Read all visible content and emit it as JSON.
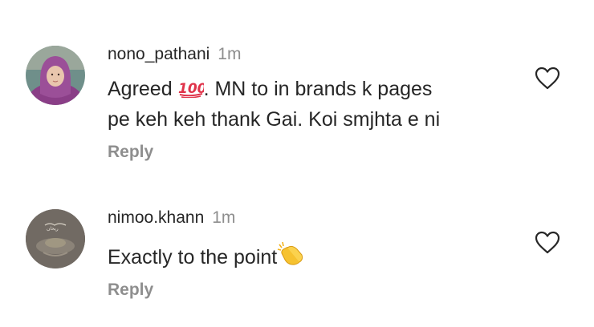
{
  "comments": [
    {
      "username": "nono_pathani",
      "time": "1m",
      "text_before_emoji": "Agreed ",
      "emoji": "hundred-points-emoji",
      "text_after_emoji": ". MN to in brands k pages",
      "text_line2": "pe keh keh thank Gai. Koi smjhta e ni",
      "reply_label": "Reply",
      "like_icon": "heart-outline-icon"
    },
    {
      "username": "nimoo.khann",
      "time": "1m",
      "text": "Exactly to the point",
      "emoji": "clapping-hands-emoji",
      "reply_label": "Reply",
      "like_icon": "heart-outline-icon"
    }
  ],
  "colors": {
    "primary_text": "#262626",
    "secondary_text": "#8e8e8e",
    "background": "#ffffff"
  }
}
